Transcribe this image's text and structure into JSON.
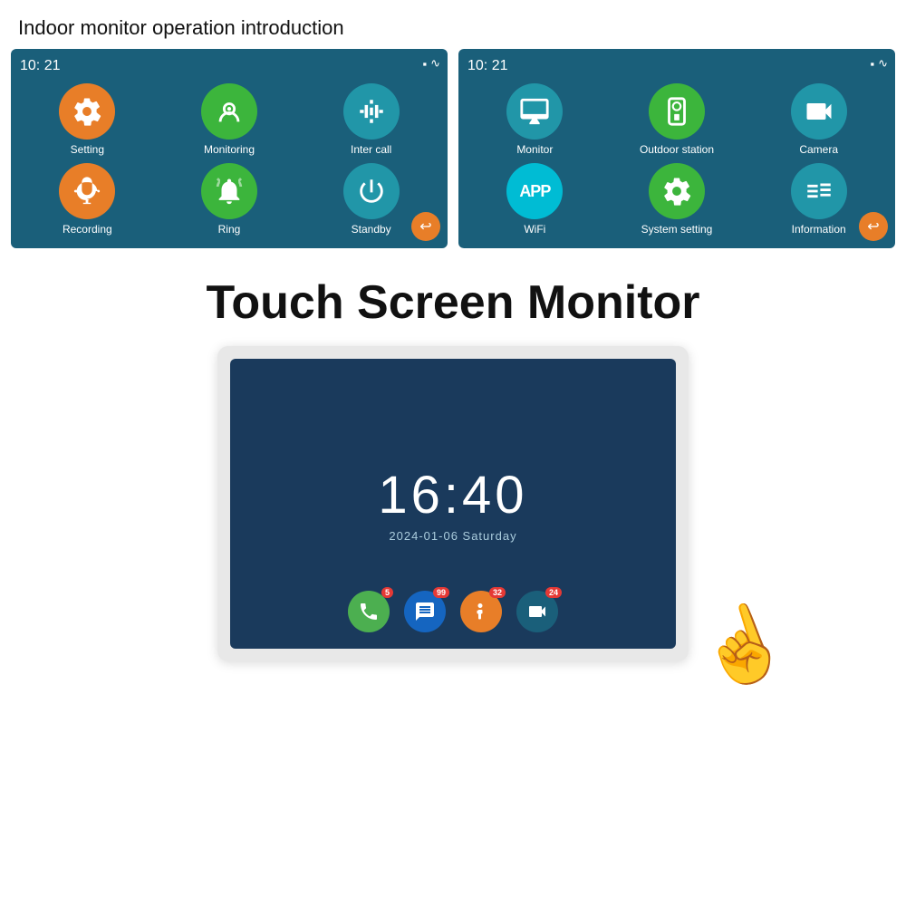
{
  "page": {
    "title": "Indoor monitor operation introduction",
    "touchScreenTitle": "Touch Screen Monitor"
  },
  "panel1": {
    "time": "10: 21",
    "icons": [
      {
        "label": "Setting",
        "color": "orange",
        "icon": "gear"
      },
      {
        "label": "Monitoring",
        "color": "green",
        "icon": "camera-monitor"
      },
      {
        "label": "Inter call",
        "color": "teal",
        "icon": "sliders"
      },
      {
        "label": "Recording",
        "color": "orange",
        "icon": "people"
      },
      {
        "label": "Ring",
        "color": "green",
        "icon": "bell"
      },
      {
        "label": "Standby",
        "color": "teal",
        "icon": "power"
      }
    ]
  },
  "panel2": {
    "time": "10: 21",
    "icons": [
      {
        "label": "Monitor",
        "color": "teal",
        "icon": "monitor"
      },
      {
        "label": "Outdoor station",
        "color": "green",
        "icon": "outdoor"
      },
      {
        "label": "Camera",
        "color": "teal",
        "icon": "camera"
      },
      {
        "label": "WiFi",
        "color": "cyan",
        "icon": "app"
      },
      {
        "label": "System setting",
        "color": "green",
        "icon": "settings"
      },
      {
        "label": "Information",
        "color": "teal",
        "icon": "list"
      }
    ]
  },
  "monitor": {
    "clock": "16:40",
    "date": "2024-01-06  Saturday",
    "bottomIcons": [
      {
        "icon": "phone",
        "color": "#4caf50",
        "badge": "5"
      },
      {
        "icon": "chat",
        "color": "#1565c0",
        "badge": "99"
      },
      {
        "icon": "person",
        "color": "#e87e28",
        "badge": "32"
      },
      {
        "icon": "video",
        "color": "#1a5f7a",
        "badge": "24"
      }
    ]
  }
}
